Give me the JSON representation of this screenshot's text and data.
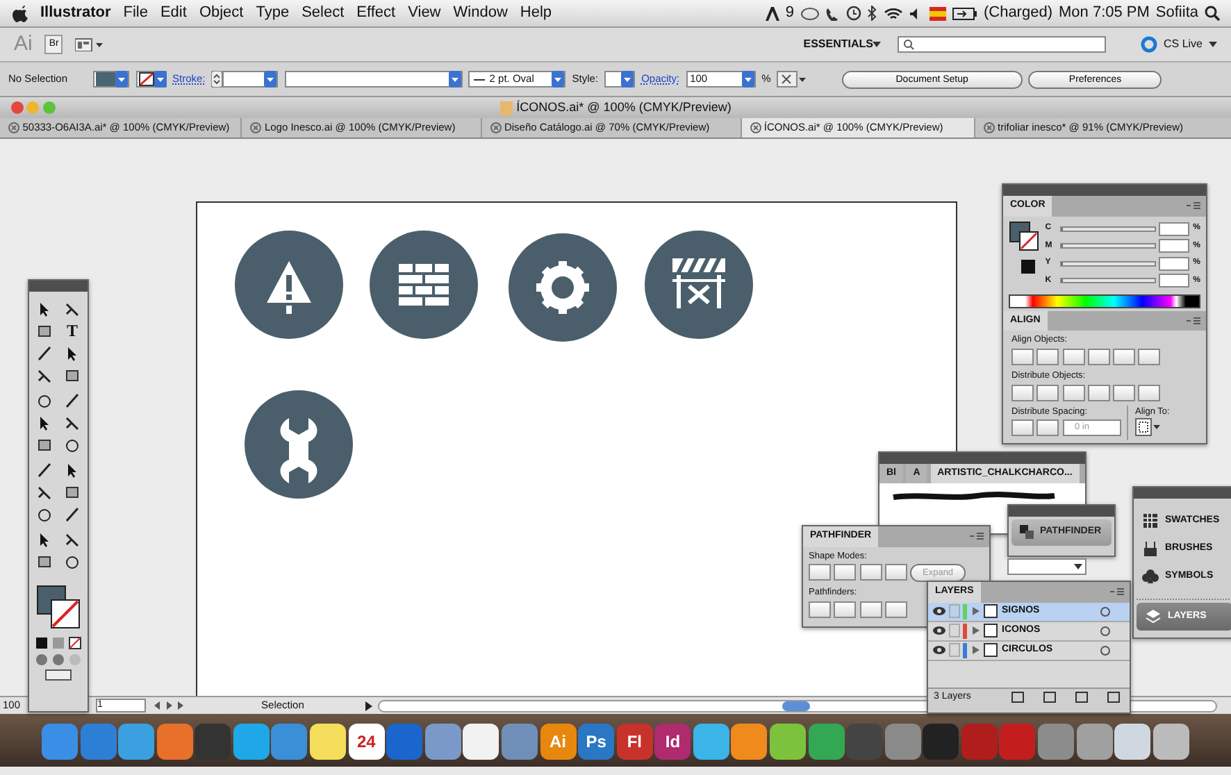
{
  "menubar": {
    "app": "Illustrator",
    "menus": [
      "File",
      "Edit",
      "Object",
      "Type",
      "Select",
      "Effect",
      "View",
      "Window",
      "Help"
    ],
    "adobe_count": "9",
    "battery": "(Charged)",
    "clock": "Mon 7:05 PM",
    "user": "Sofiita"
  },
  "appbar": {
    "logo": "Ai",
    "bridge": "Br",
    "workspace": "ESSENTIALS",
    "cs_live": "CS Live"
  },
  "control_bar": {
    "selection": "No Selection",
    "stroke_label": "Stroke:",
    "brush": "2 pt. Oval",
    "style_label": "Style:",
    "opacity_label": "Opacity:",
    "opacity": "100",
    "percent": "%",
    "buttons": [
      "Document Setup",
      "Preferences"
    ]
  },
  "document": {
    "title": "ÍCONOS.ai* @ 100% (CMYK/Preview)",
    "tabs": [
      {
        "label": "50333-O6AI3A.ai* @ 100% (CMYK/Preview)",
        "selected": false
      },
      {
        "label": "Logo Inesco.ai @ 100% (CMYK/Preview)",
        "selected": false
      },
      {
        "label": "Diseño Catálogo.ai @ 70% (CMYK/Preview)",
        "selected": false
      },
      {
        "label": "ÍCONOS.ai* @ 100% (CMYK/Preview)",
        "selected": true
      },
      {
        "label": "trifoliar inesco* @ 91% (CMYK/Preview)",
        "selected": false
      }
    ]
  },
  "artboard": {
    "icons": [
      {
        "kind": "warning"
      },
      {
        "kind": "bricks"
      },
      {
        "kind": "gear"
      },
      {
        "kind": "barrier"
      },
      {
        "kind": "wrench"
      }
    ]
  },
  "tools_panel": {
    "type_tool": "T"
  },
  "color_panel": {
    "title": "COLOR",
    "channels": [
      {
        "name": "C",
        "level": 0
      },
      {
        "name": "M",
        "level": 0
      },
      {
        "name": "Y",
        "level": 0
      },
      {
        "name": "K",
        "level": 0
      }
    ],
    "unit": "%"
  },
  "align_panel": {
    "title": "ALIGN",
    "align_objects": "Align Objects:",
    "distribute_objects": "Distribute Objects:",
    "distribute_spacing": "Distribute Spacing:",
    "align_to": "Align To:",
    "spacing": "0 in"
  },
  "brushes_panel": {
    "tabs": [
      {
        "label": "Bl",
        "selected": false
      },
      {
        "label": "A",
        "selected": false
      },
      {
        "label": "ARTISTIC_CHALKCHARCO...",
        "selected": true
      }
    ]
  },
  "pathfinder_panel": {
    "title": "PATHFINDER",
    "shape_modes": "Shape Modes:",
    "expand": "Expand",
    "pathfinders": "Pathfinders:"
  },
  "pathfinder_collapsed": {
    "label": "PATHFINDER"
  },
  "panel_dock": {
    "items": [
      {
        "label": "SWATCHES",
        "kind": "swatches",
        "selected": false
      },
      {
        "label": "BRUSHES",
        "kind": "brushes",
        "selected": false
      },
      {
        "label": "SYMBOLS",
        "kind": "symbols",
        "selected": false
      },
      {
        "label": "LAYERS",
        "kind": "layers",
        "selected": true
      }
    ]
  },
  "layers_panel": {
    "title": "LAYERS",
    "layers": [
      {
        "name": "SIGNOS",
        "color": "#5cd65c",
        "selected": true
      },
      {
        "name": "ICONOS",
        "color": "#e0483c",
        "selected": false
      },
      {
        "name": "CIRCULOS",
        "color": "#3b7bdc",
        "selected": false
      }
    ],
    "footer": "3 Layers"
  },
  "status_bar": {
    "zoom": "100",
    "page": "1",
    "tool": "Selection"
  },
  "dock": [
    {
      "color": "#3a8ee6"
    },
    {
      "color": "#2d7fd6"
    },
    {
      "color": "#3aa0e0"
    },
    {
      "color": "#e8702a"
    },
    {
      "color": "#333333"
    },
    {
      "color": "#1fa8e8"
    },
    {
      "color": "#3b8fd6"
    },
    {
      "color": "#f4dd5a"
    },
    {
      "color": "#ffffff",
      "label": "24"
    },
    {
      "color": "#1a66cc"
    },
    {
      "color": "#7a99c9"
    },
    {
      "color": "#f2f2f2"
    },
    {
      "color": "#6f8fb8"
    },
    {
      "color": "#e8870e",
      "label": "Ai"
    },
    {
      "color": "#2a77c4",
      "label": "Ps"
    },
    {
      "color": "#c8322b",
      "label": "Fl"
    },
    {
      "color": "#b02a6f",
      "label": "Id"
    },
    {
      "color": "#3bb4e8"
    },
    {
      "color": "#f08a1c"
    },
    {
      "color": "#7cc23c"
    },
    {
      "color": "#33a853"
    },
    {
      "color": "#444444"
    },
    {
      "color": "#8a8a8a"
    },
    {
      "color": "#222222"
    },
    {
      "color": "#b01d1d"
    },
    {
      "color": "#c41d1d"
    },
    {
      "color": "#8c8c8c"
    },
    {
      "color": "#a0a0a0"
    },
    {
      "color": "#cfd8e0"
    },
    {
      "color": "#bbbbbb"
    }
  ]
}
